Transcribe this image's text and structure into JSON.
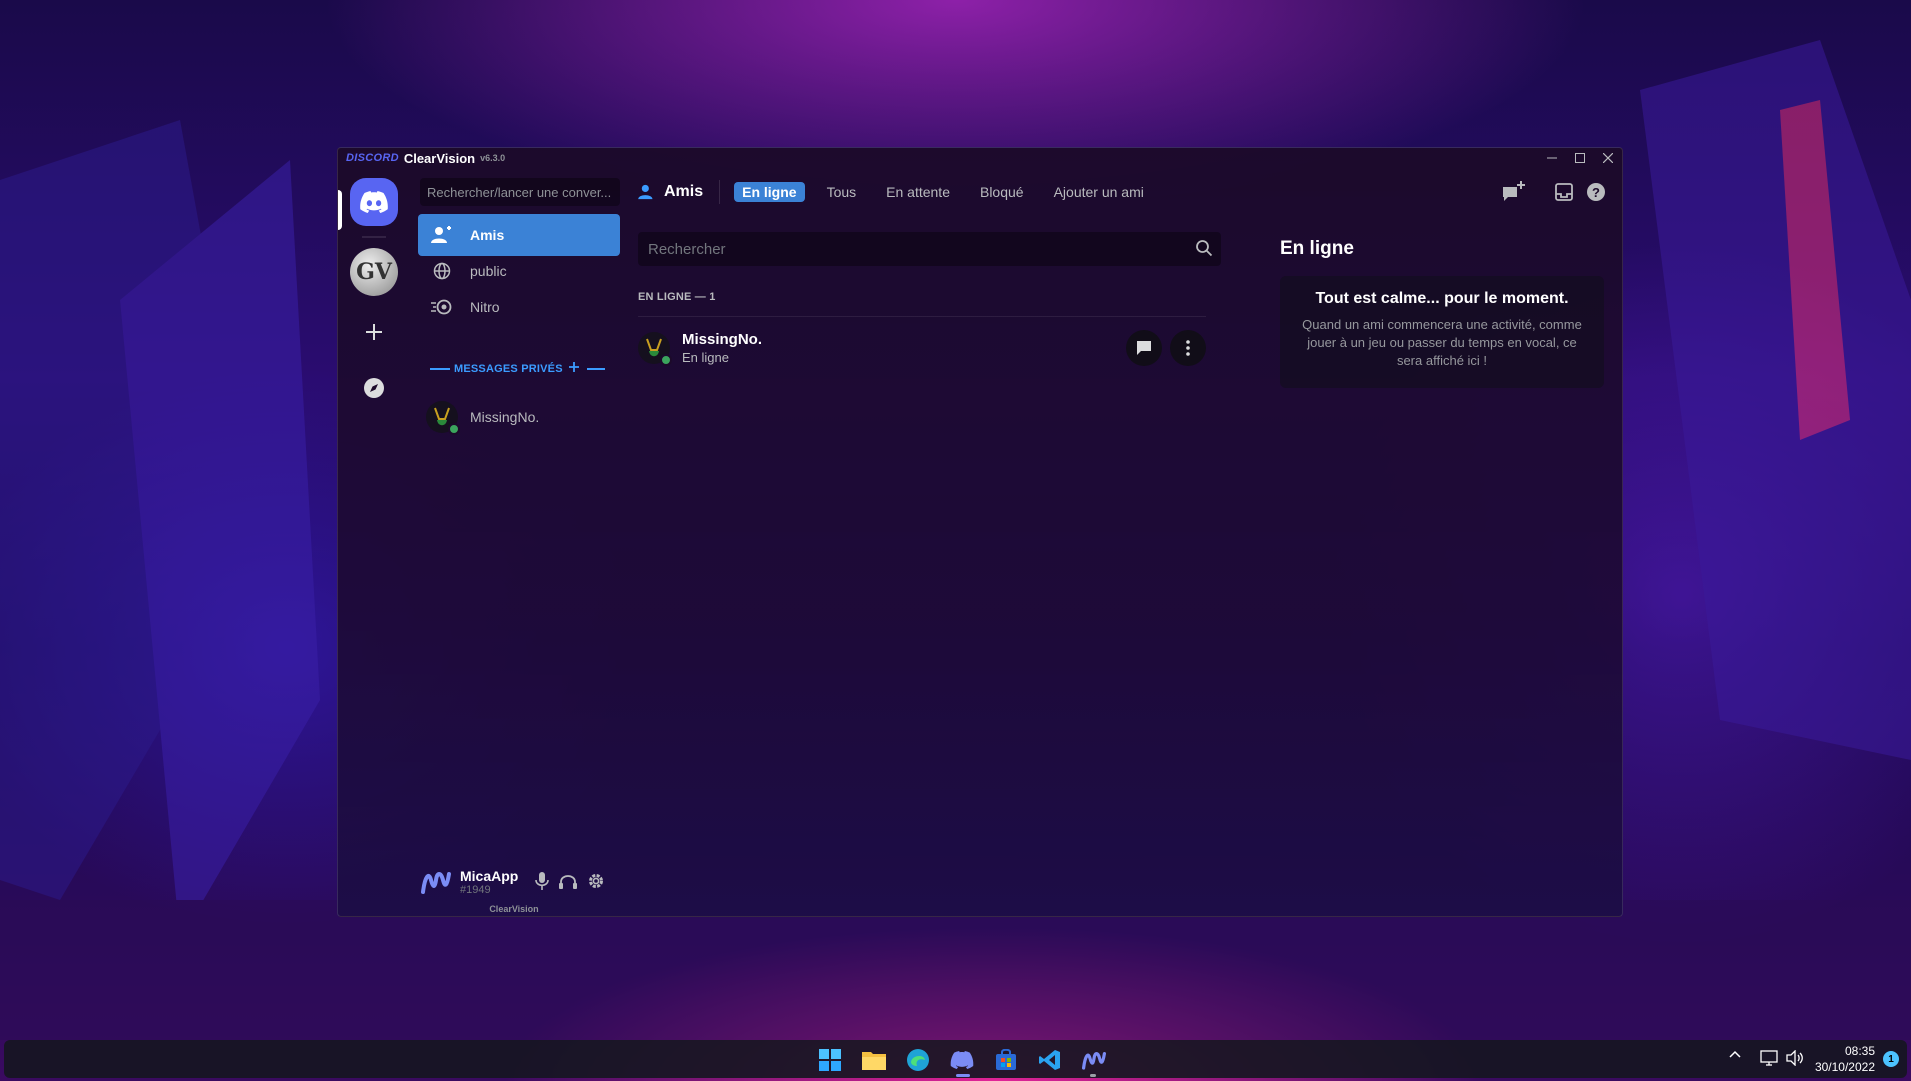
{
  "window": {
    "brand": "DISCORD",
    "app_name": "ClearVision",
    "app_version": "v6.3.0"
  },
  "sidebar": {
    "search_placeholder": "Rechercher/lancer une conver...",
    "nav": [
      {
        "label": "Amis",
        "icon": "friends-icon",
        "active": true
      },
      {
        "label": "public",
        "icon": "globe-icon",
        "active": false
      },
      {
        "label": "Nitro",
        "icon": "nitro-icon",
        "active": false
      }
    ],
    "dm_header": "MESSAGES PRIVÉS",
    "dms": [
      {
        "name": "MissingNo.",
        "status": "online"
      }
    ]
  },
  "user": {
    "name": "MicaApp",
    "tag": "#1949",
    "footer": "ClearVision"
  },
  "topbar": {
    "title": "Amis",
    "tabs": [
      {
        "label": "En ligne",
        "active": true
      },
      {
        "label": "Tous",
        "active": false
      },
      {
        "label": "En attente",
        "active": false
      },
      {
        "label": "Bloqué",
        "active": false
      },
      {
        "label": "Ajouter un ami",
        "active": false
      }
    ]
  },
  "friends": {
    "search_placeholder": "Rechercher",
    "section_title": "EN LIGNE — 1",
    "list": [
      {
        "name": "MissingNo.",
        "status": "En ligne"
      }
    ]
  },
  "activity": {
    "title": "En ligne",
    "card_title": "Tout est calme... pour le moment.",
    "card_text": "Quand un ami commencera une activité, comme jouer à un jeu ou passer du temps en vocal, ce sera affiché ici !"
  },
  "taskbar": {
    "time": "08:35",
    "date": "30/10/2022",
    "notifications": "1"
  },
  "colors": {
    "accent": "#3b82d6",
    "blurple": "#5865f2",
    "online": "#3ba55d"
  }
}
